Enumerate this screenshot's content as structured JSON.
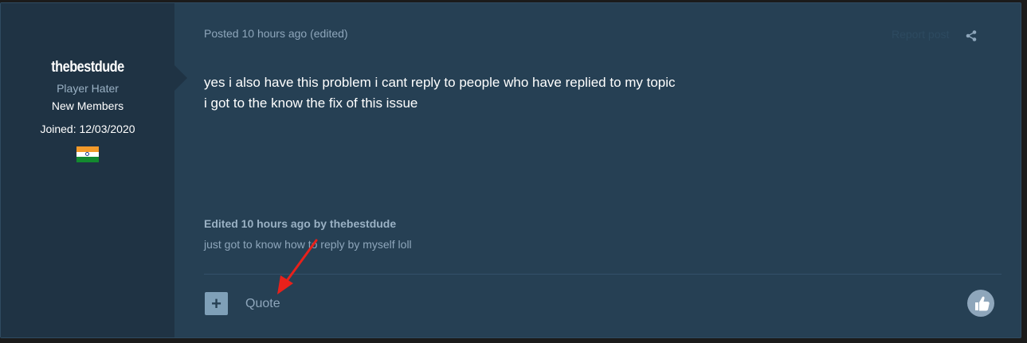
{
  "author": {
    "username": "thebestdude",
    "rank": "Player Hater",
    "group": "New Members",
    "joined": "Joined: 12/03/2020",
    "flag_icon": "india-flag-icon"
  },
  "post": {
    "meta": "Posted 10 hours ago (edited)",
    "report_label": "Report post",
    "share_icon": "share-icon",
    "content_lines": [
      "yes i also have this problem i cant reply to people who have replied to my topic",
      "i got to the know the fix of this issue"
    ],
    "edit": {
      "edited_by": "Edited 10 hours ago by thebestdude",
      "reason": "just got to know how to reply by myself loll"
    }
  },
  "footer": {
    "multiquote_label": "+",
    "quote_label": "Quote",
    "like_icon": "thumbs-up-icon"
  },
  "annotation": {
    "arrow_color": "#e8211b"
  },
  "colors": {
    "post_bg": "#264054",
    "author_bg": "#1f3344",
    "muted_text": "#8ea6bb"
  }
}
